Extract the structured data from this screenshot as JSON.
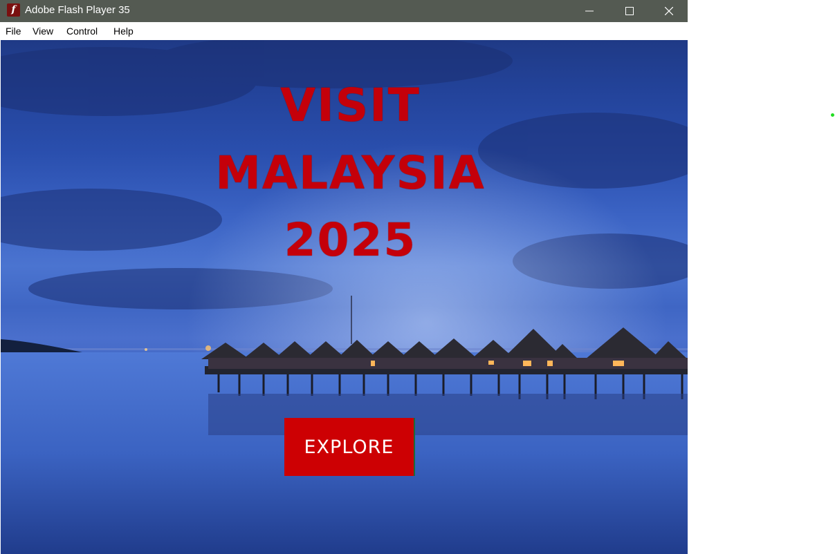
{
  "window": {
    "title": "Adobe Flash Player 35",
    "app_icon_glyph": "f",
    "app_icon_color": "#7a1010",
    "titlebar_color": "#545a52",
    "controls": [
      "minimize-icon",
      "maximize-icon",
      "close-icon"
    ]
  },
  "menubar": {
    "items": [
      {
        "label": "File"
      },
      {
        "label": "View"
      },
      {
        "label": "Control"
      },
      {
        "label": "Help"
      }
    ]
  },
  "stage": {
    "headline_line1": "VISIT",
    "headline_line2": "MALAYSIA",
    "headline_line3": "2025",
    "headline_color": "#c4000a",
    "explore_label": "EXPLORE",
    "explore_color": "#cd0003",
    "background_scene": "dusk sky over calm sea with over-water bungalows on stilts"
  }
}
